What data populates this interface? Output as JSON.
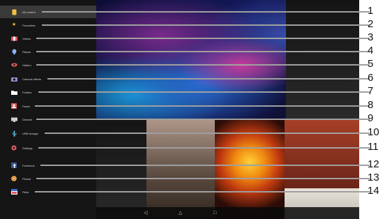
{
  "drawer": {
    "items": [
      {
        "label": "All content",
        "icon": "all-content-icon"
      },
      {
        "label": "Favourites",
        "icon": "star-icon"
      },
      {
        "label": "Videos",
        "icon": "video-icon"
      },
      {
        "label": "Places",
        "icon": "location-pin-icon"
      },
      {
        "label": "Hidden",
        "icon": "eye-icon"
      },
      {
        "label": "Camera effects",
        "icon": "camera-icon"
      },
      {
        "label": "Folders",
        "icon": "folder-icon"
      },
      {
        "label": "Faces",
        "icon": "face-icon"
      },
      {
        "label": "Devices",
        "icon": "devices-icon"
      },
      {
        "label": "USB storage",
        "icon": "usb-icon"
      },
      {
        "label": "Settings",
        "icon": "settings-icon"
      },
      {
        "label": "Facebook",
        "icon": "facebook-icon"
      },
      {
        "label": "Picasa",
        "icon": "picasa-icon"
      },
      {
        "label": "Flickr",
        "icon": "flickr-icon"
      }
    ],
    "selected": "All content"
  },
  "callouts": [
    "1",
    "2",
    "3",
    "4",
    "5",
    "6",
    "7",
    "8",
    "9",
    "10",
    "11",
    "12",
    "13",
    "14"
  ],
  "navbar": {
    "back": "◁",
    "home": "△",
    "recents": "□"
  },
  "colors": {
    "drawer_bg": "#151515",
    "selected_bg": "#3a3a3a",
    "callout_line": "#a0a0a0"
  }
}
